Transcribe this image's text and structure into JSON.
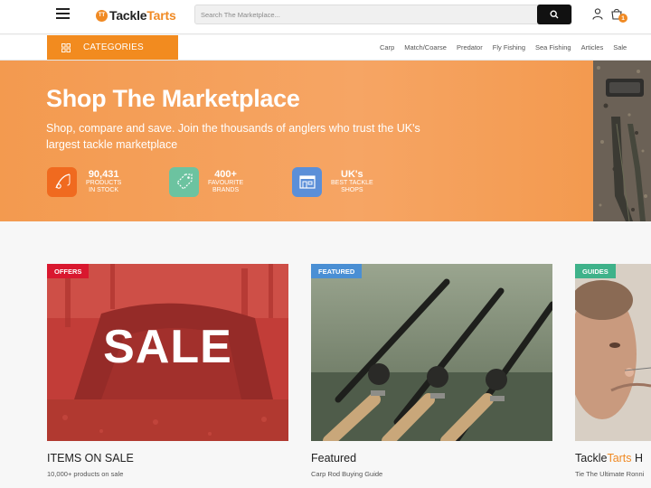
{
  "header": {
    "logo_badge": "TT",
    "logo_prefix": "Tackle",
    "logo_accent": "Tarts",
    "search_placeholder": "Search The Marketplace...",
    "cart_count": "1"
  },
  "nav": {
    "categories_label": "CATEGORIES",
    "links": [
      "Carp",
      "Match/Coarse",
      "Predator",
      "Fly Fishing",
      "Sea Fishing",
      "Articles",
      "Sale"
    ]
  },
  "hero": {
    "title": "Shop The Marketplace",
    "subtitle": "Shop, compare and save. Join the thousands of anglers who trust the UK's largest tackle marketplace",
    "stats": [
      {
        "value": "90,431",
        "caption_line1": "PRODUCTS",
        "caption_line2": "IN STOCK",
        "icon": "fishing-rod-icon",
        "color": "#f06a1f"
      },
      {
        "value": "400+",
        "caption_line1": "FAVOURITE",
        "caption_line2": "BRANDS",
        "icon": "price-tag-icon",
        "color": "#6cc3a0"
      },
      {
        "value": "UK's",
        "caption_line1": "BEST TACKLE",
        "caption_line2": "SHOPS",
        "icon": "shop-icon",
        "color": "#5b8fd8"
      }
    ]
  },
  "cards": [
    {
      "tag": "OFFERS",
      "tag_color": "#d9182f",
      "image_text": "SALE",
      "title": "ITEMS ON SALE",
      "subtitle": "10,000+ products on sale"
    },
    {
      "tag": "FEATURED",
      "tag_color": "#4a8fd4",
      "title": "Featured",
      "subtitle": "Carp Rod Buying Guide"
    },
    {
      "tag": "GUIDES",
      "tag_color": "#3fb28a",
      "title_prefix": "Tackle",
      "title_accent": "Tarts",
      "title_suffix": " H",
      "subtitle": "Tie The Ultimate Ronni"
    }
  ],
  "colors": {
    "brand_orange": "#f08a24",
    "hero_bg": "#f6a564"
  }
}
